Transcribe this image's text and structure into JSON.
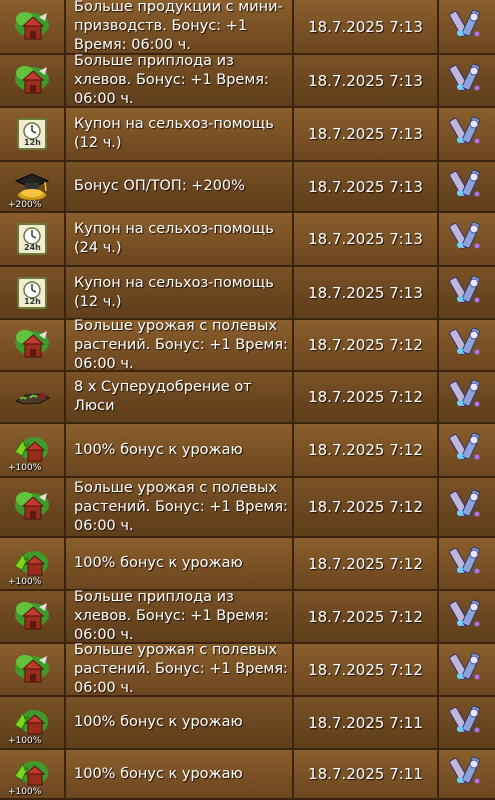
{
  "rows": [
    {
      "icon": "barn-tree-icon",
      "text": "Больше продукции с мини-призводств. Бонус: +1 Время: 06:00 ч.",
      "date": "18.7.2025 7:13"
    },
    {
      "icon": "barn-tree-icon",
      "text": "Больше приплода из хлевов. Бонус: +1 Время: 06:00 ч.",
      "date": "18.7.2025 7:13"
    },
    {
      "icon": "clock-coupon-icon",
      "sub": "12h",
      "text": "Купон на сельхоз-помощь (12 ч.)",
      "date": "18.7.2025 7:13"
    },
    {
      "icon": "graduation-cap-icon",
      "sub": "+200%",
      "text": "Бонус ОП/ТОП: +200%",
      "date": "18.7.2025 7:13"
    },
    {
      "icon": "clock-coupon-icon",
      "sub": "24h",
      "text": "Купон на сельхоз-помощь (24 ч.)",
      "date": "18.7.2025 7:13"
    },
    {
      "icon": "clock-coupon-icon",
      "sub": "12h",
      "text": "Купон на сельхоз-помощь (12 ч.)",
      "date": "18.7.2025 7:13"
    },
    {
      "icon": "barn-tree-icon",
      "text": "Больше урожая с полевых растений. Бонус: +1 Время: 06:00 ч.",
      "date": "18.7.2025 7:12"
    },
    {
      "icon": "fertilizer-icon",
      "text": "8 x Суперудобрение от Люси",
      "date": "18.7.2025 7:12"
    },
    {
      "icon": "harvest-bonus-icon",
      "sub": "+100%",
      "text": "100% бонус к урожаю",
      "date": "18.7.2025 7:12"
    },
    {
      "icon": "barn-tree-icon",
      "text": "Больше урожая с полевых растений. Бонус: +1 Время: 06:00 ч.",
      "date": "18.7.2025 7:12"
    },
    {
      "icon": "harvest-bonus-icon",
      "sub": "+100%",
      "text": "100% бонус к урожаю",
      "date": "18.7.2025 7:12"
    },
    {
      "icon": "barn-tree-icon",
      "text": "Больше приплода из хлевов. Бонус: +1 Время: 06:00 ч.",
      "date": "18.7.2025 7:12"
    },
    {
      "icon": "barn-tree-icon",
      "text": "Больше урожая с полевых растений. Бонус: +1 Время: 06:00 ч.",
      "date": "18.7.2025 7:12"
    },
    {
      "icon": "harvest-bonus-icon",
      "sub": "+100%",
      "text": "100% бонус к урожаю",
      "date": "18.7.2025 7:11"
    },
    {
      "icon": "harvest-bonus-icon",
      "sub": "+100%",
      "text": "100% бонус к урожаю",
      "date": "18.7.2025 7:11"
    }
  ]
}
